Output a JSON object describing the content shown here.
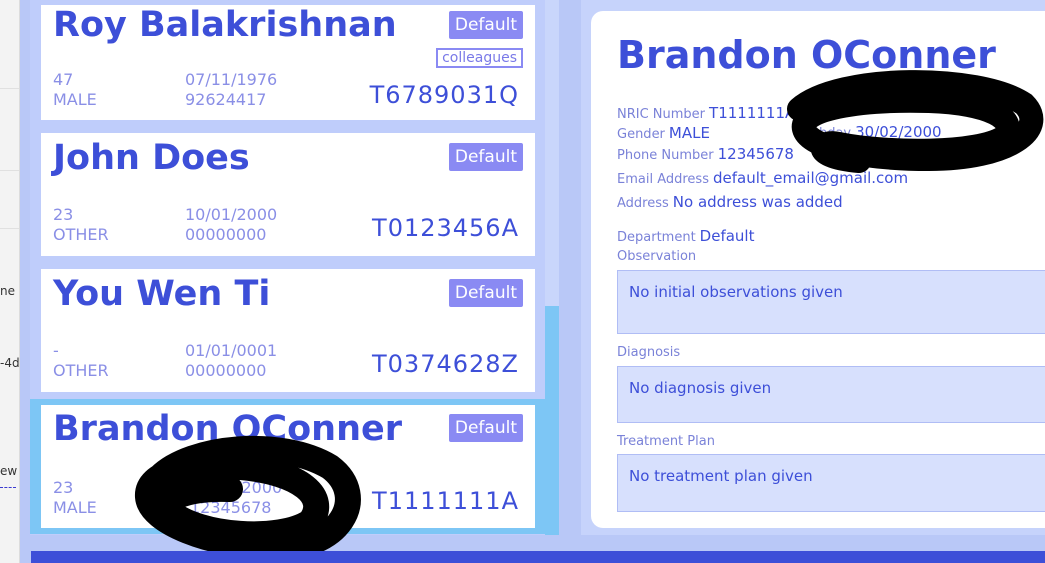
{
  "background_window": {
    "fragments": [
      "ne c",
      "-4d",
      "ew"
    ]
  },
  "patients": [
    {
      "name": "Roy Balakrishnan",
      "department": "Default",
      "tag": "colleagues",
      "age": "47",
      "gender": "MALE",
      "birthday": "07/11/1976",
      "phone": "92624417",
      "nric": "T6789031Q"
    },
    {
      "name": "John Does",
      "department": "Default",
      "age": "23",
      "gender": "OTHER",
      "birthday": "10/01/2000",
      "phone": "00000000",
      "nric": "T0123456A"
    },
    {
      "name": "You Wen Ti",
      "department": "Default",
      "age": "-",
      "gender": "OTHER",
      "birthday": "01/01/0001",
      "phone": "00000000",
      "nric": "T0374628Z"
    },
    {
      "name": "Brandon OConner",
      "department": "Default",
      "age": "23",
      "gender": "MALE",
      "birthday": "29/02/2000",
      "phone": "12345678",
      "nric": "T1111111A",
      "selected": true
    }
  ],
  "detail": {
    "name": "Brandon OConner",
    "nric_label": "NRIC Number",
    "nric": "T1111111A",
    "gender_label": "Gender",
    "gender": "MALE",
    "birthday_label": "Birthday",
    "birthday": "30/02/2000",
    "phone_label": "Phone Number",
    "phone": "12345678",
    "email_label": "Email Address",
    "email": "default_email@gmail.com",
    "address_label": "Address",
    "address": "No address was added",
    "department_label": "Department",
    "department": "Default",
    "observation_label": "Observation",
    "observation": "No initial observations given",
    "diagnosis_label": "Diagnosis",
    "diagnosis": "No diagnosis given",
    "treatment_label": "Treatment Plan",
    "treatment": "No treatment plan given"
  },
  "colors": {
    "accent": "#3d4fd8",
    "button": "#8a8af3",
    "selection": "#7dc6f5",
    "panel": "#bfcdfb"
  }
}
